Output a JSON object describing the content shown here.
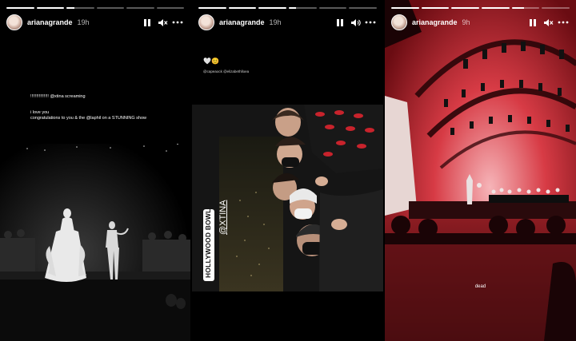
{
  "stories": [
    {
      "username": "arianagrande",
      "time": "19h",
      "progress": [
        1,
        1,
        0.3,
        0,
        0,
        0
      ],
      "caption_lines": [
        "!!!!!!!!!!!!!!! @xtina screaming",
        "i love you",
        "congratulations to you & the @laphil on a STUNNING show"
      ]
    },
    {
      "username": "arianagrande",
      "time": "19h",
      "progress": [
        1,
        1,
        1,
        0.25,
        0,
        0
      ],
      "emoji": "🤍😊",
      "mentions": "@capeaock @elizabethlloea",
      "location_sticker": "HOLLYWOOD BOWL",
      "mention_sticker": "@XTINA"
    },
    {
      "username": "arianagrande",
      "time": "9h",
      "progress": [
        1,
        1,
        1,
        1,
        0.45,
        0
      ],
      "caption": "dead"
    }
  ],
  "icons": [
    "pause-icon",
    "mute-icon",
    "more-icon"
  ],
  "colors": {
    "stage_red": "#c6242c",
    "dark": "#000000"
  }
}
